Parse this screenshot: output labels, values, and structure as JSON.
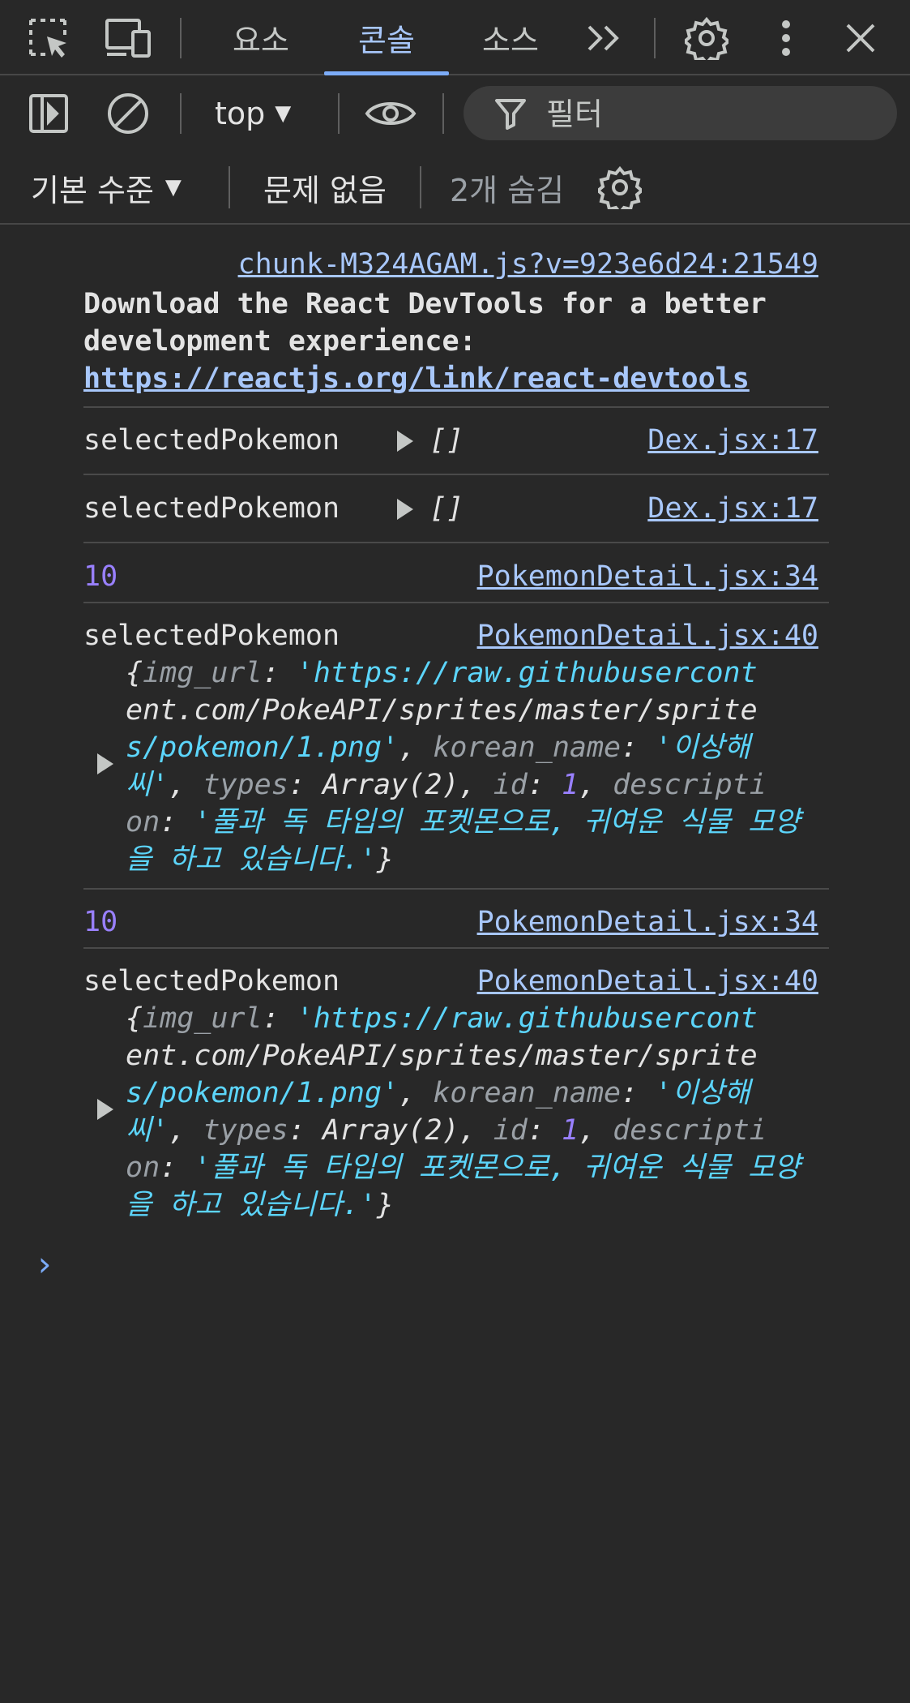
{
  "tabs": [
    "요소",
    "콘솔",
    "소스"
  ],
  "active_tab": "콘솔",
  "toolbar": {
    "context": "top",
    "filter_placeholder": "필터",
    "level": "기본 수준",
    "issues": "문제 없음",
    "hidden": "2개 숨김"
  },
  "console": {
    "first_source": "chunk-M324AGAM.js?v=923e6d24:21549",
    "react_line1": "Download the React DevTools for a better",
    "react_line2": "development experience:",
    "react_link": "https://reactjs.org/link/react-devtools",
    "log1": {
      "label": "selectedPokemon",
      "value": "[]",
      "source": "Dex.jsx:17"
    },
    "log2": {
      "label": "selectedPokemon",
      "value": "[]",
      "source": "Dex.jsx:17"
    },
    "log3": {
      "value": "10",
      "source": "PokemonDetail.jsx:34"
    },
    "log4": {
      "label": "selectedPokemon",
      "source": "PokemonDetail.jsx:40",
      "url_part1": "https://raw.githubusercont",
      "url_part2": "ent.com/PokeAPI/sprites/master/sprite",
      "url_part3": "s/pokemon/1.png",
      "korean_name_part1": "이상해",
      "korean_name_part2": "씨",
      "types": "Array(2)",
      "id": "1",
      "desc_key_part1": "descripti",
      "desc_key_part2": "on",
      "desc_part1": "풀과 독 타입의 포켓몬으로, 귀여운 식물 모양",
      "desc_part2": "을 하고 있습니다."
    },
    "log5": {
      "value": "10",
      "source": "PokemonDetail.jsx:34"
    },
    "log6": {
      "label": "selectedPokemon",
      "source": "PokemonDetail.jsx:40",
      "url_part1": "https://raw.githubusercont",
      "url_part2": "ent.com/PokeAPI/sprites/master/sprite",
      "url_part3": "s/pokemon/1.png",
      "korean_name_part1": "이상해",
      "korean_name_part2": "씨",
      "types": "Array(2)",
      "id": "1",
      "desc_key_part1": "descripti",
      "desc_key_part2": "on",
      "desc_part1": "풀과 독 타입의 포켓몬으로, 귀여운 식물 모양",
      "desc_part2": "을 하고 있습니다."
    },
    "prompt": "›"
  },
  "colors": {
    "background": "#282828",
    "accent": "#a8c7fa",
    "string": "#5cd5fb",
    "number": "#9980ff"
  }
}
